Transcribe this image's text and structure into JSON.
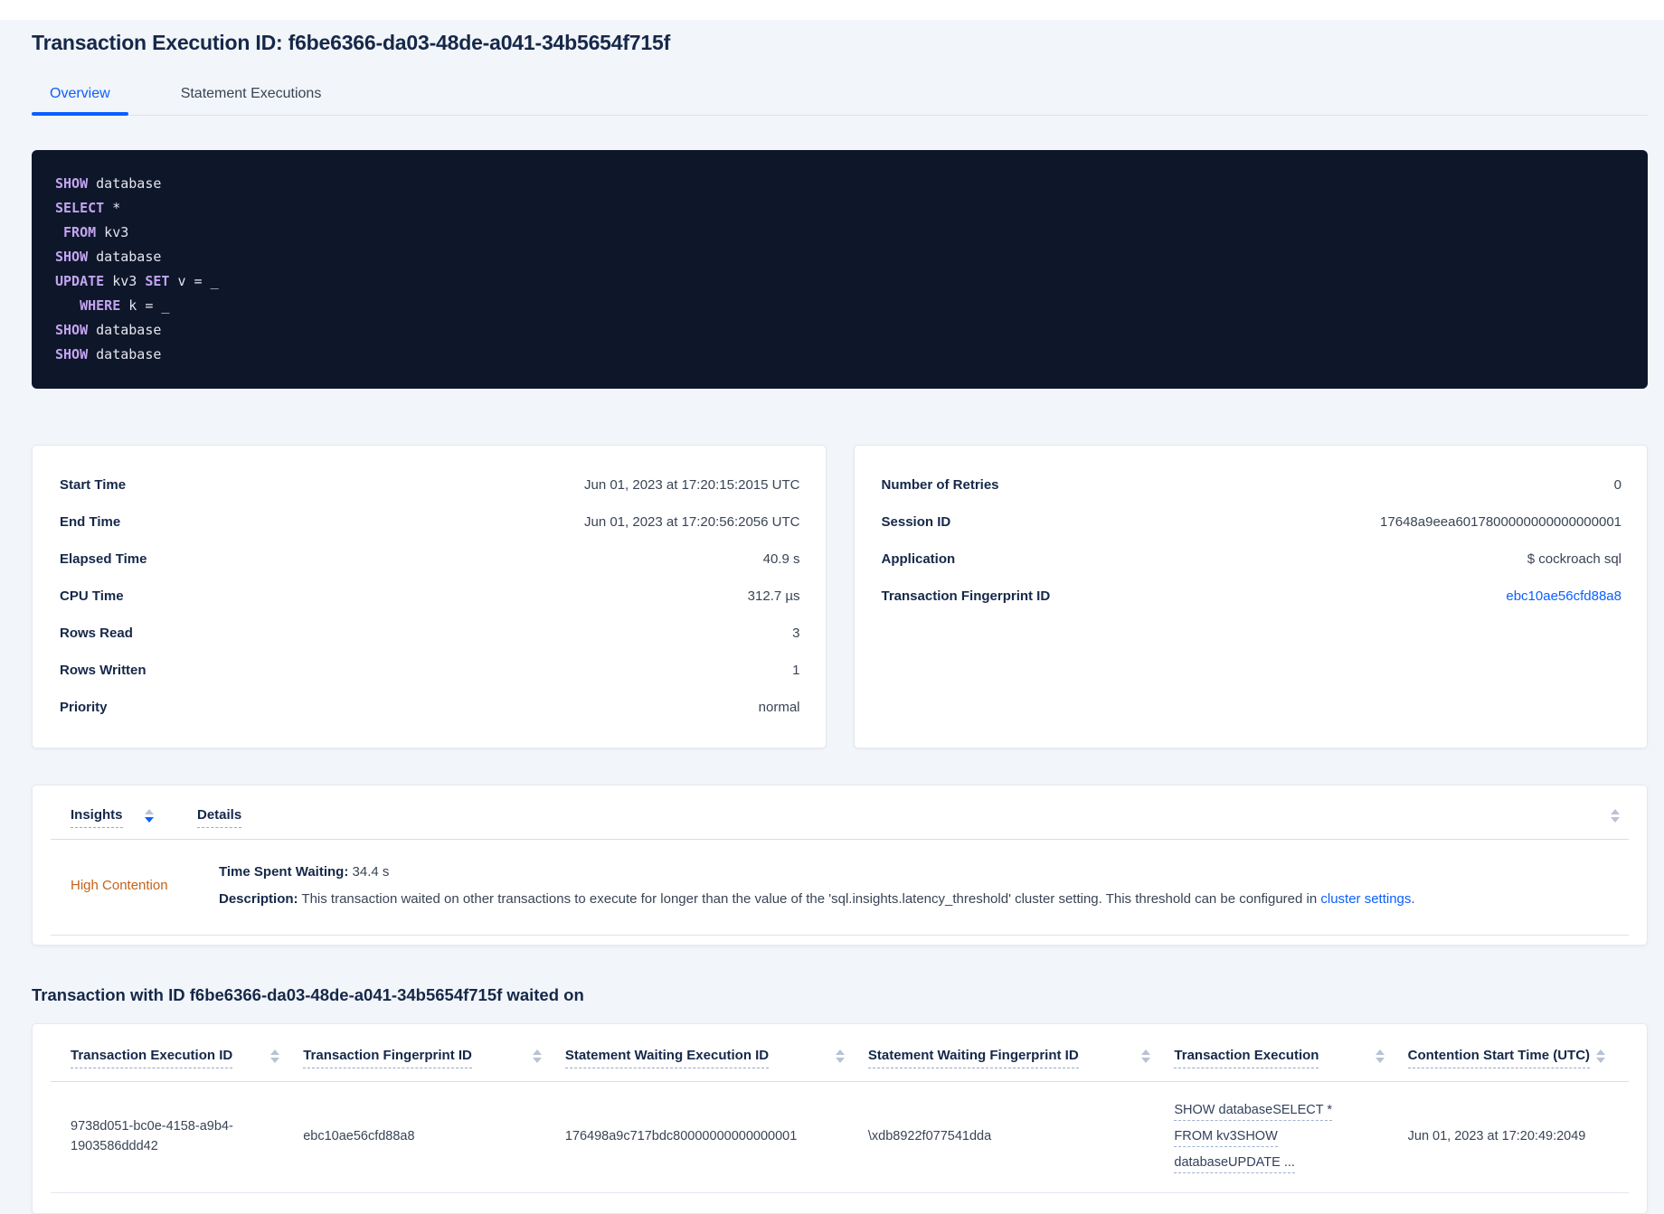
{
  "header": {
    "title": "Transaction Execution ID: f6be6366-da03-48de-a041-34b5654f715f"
  },
  "tabs": {
    "overview": "Overview",
    "statement_executions": "Statement Executions"
  },
  "colors": {
    "accent_blue": "#0b5fff",
    "insight_orange": "#c4621a",
    "code_background": "#0e1729",
    "code_keyword": "#c3a4f1"
  },
  "sql_box": {
    "lines": [
      [
        [
          "k",
          "SHOW"
        ],
        [
          "p",
          " database"
        ]
      ],
      [
        [
          "k",
          "SELECT"
        ],
        [
          "p",
          " *"
        ]
      ],
      [
        [
          "p",
          " "
        ],
        [
          "k",
          "FROM"
        ],
        [
          "p",
          " kv3"
        ]
      ],
      [
        [
          "k",
          "SHOW"
        ],
        [
          "p",
          " database"
        ]
      ],
      [
        [
          "k",
          "UPDATE"
        ],
        [
          "p",
          " kv3 "
        ],
        [
          "k",
          "SET"
        ],
        [
          "p",
          " v = _"
        ]
      ],
      [
        [
          "p",
          "   "
        ],
        [
          "k",
          "WHERE"
        ],
        [
          "p",
          " k = _"
        ]
      ],
      [
        [
          "k",
          "SHOW"
        ],
        [
          "p",
          " database"
        ]
      ],
      [
        [
          "k",
          "SHOW"
        ],
        [
          "p",
          " database"
        ]
      ]
    ]
  },
  "stats_left": {
    "rows": [
      {
        "label": "Start Time",
        "value": "Jun 01, 2023 at 17:20:15:2015 UTC"
      },
      {
        "label": "End Time",
        "value": "Jun 01, 2023 at 17:20:56:2056 UTC"
      },
      {
        "label": "Elapsed Time",
        "value": "40.9 s"
      },
      {
        "label": "CPU Time",
        "value": "312.7 µs"
      },
      {
        "label": "Rows Read",
        "value": "3"
      },
      {
        "label": "Rows Written",
        "value": "1"
      },
      {
        "label": "Priority",
        "value": "normal"
      }
    ]
  },
  "stats_right": {
    "rows": [
      {
        "label": "Number of Retries",
        "value": "0"
      },
      {
        "label": "Session ID",
        "value": "17648a9eea6017800000000000000001"
      },
      {
        "label": "Application",
        "value": "$ cockroach sql"
      },
      {
        "label": "Transaction Fingerprint ID",
        "value": "ebc10ae56cfd88a8"
      }
    ]
  },
  "insights_table": {
    "columns": {
      "insights": "Insights",
      "details": "Details"
    },
    "row": {
      "insight": "High Contention",
      "time_spent_waiting_label": "Time Spent Waiting:",
      "time_spent_waiting_value": " 34.4 s",
      "description_label": "Description:",
      "description_text": " This transaction waited on other transactions to execute for longer than the value of the 'sql.insights.latency_threshold' cluster setting. This threshold can be configured in ",
      "description_link": "cluster settings",
      "description_suffix": "."
    }
  },
  "waited_on": {
    "heading": "Transaction with ID f6be6366-da03-48de-a041-34b5654f715f waited on",
    "columns": [
      "Transaction Execution ID",
      "Transaction Fingerprint ID",
      "Statement Waiting Execution ID",
      "Statement Waiting Fingerprint ID",
      "Transaction Execution",
      "Contention Start Time (UTC)"
    ],
    "row": {
      "transaction_execution_id": "9738d051-bc0e-4158-a9b4-1903586ddd42",
      "transaction_fingerprint_id": "ebc10ae56cfd88a8",
      "statement_waiting_execution_id": "176498a9c717bdc80000000000000001",
      "statement_waiting_fingerprint_id": "\\xdb8922f077541dda",
      "transaction_execution_lines": [
        "SHOW databaseSELECT *",
        "FROM kv3SHOW",
        "databaseUPDATE ..."
      ],
      "contention_start_time": "Jun 01, 2023 at 17:20:49:2049"
    }
  }
}
